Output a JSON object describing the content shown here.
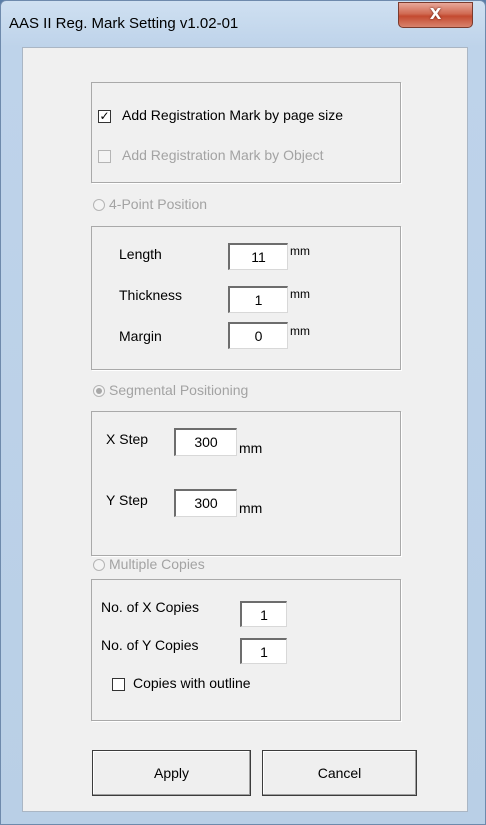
{
  "window": {
    "title": "AAS II Reg. Mark Setting v1.02-01",
    "close_label": "X"
  },
  "options": {
    "by_page_size": {
      "label": "Add Registration Mark by page size",
      "checked": true
    },
    "by_object": {
      "label": "Add Registration Mark by Object",
      "checked": false
    }
  },
  "four_point": {
    "label": "4-Point Position",
    "length": {
      "label": "Length",
      "value": "11",
      "unit": "mm"
    },
    "thickness": {
      "label": "Thickness",
      "value": "1",
      "unit": "mm"
    },
    "margin": {
      "label": "Margin",
      "value": "0",
      "unit": "mm"
    }
  },
  "segmental": {
    "label": "Segmental Positioning",
    "selected": true,
    "x_step": {
      "label": "X Step",
      "value": "300",
      "unit": "mm"
    },
    "y_step": {
      "label": "Y Step",
      "value": "300",
      "unit": "mm"
    }
  },
  "multiple": {
    "label": "Multiple Copies",
    "x_copies": {
      "label": "No. of X Copies",
      "value": "1"
    },
    "y_copies": {
      "label": "No. of Y Copies",
      "value": "1"
    },
    "outline": {
      "label": "Copies with outline",
      "checked": false
    }
  },
  "buttons": {
    "apply": "Apply",
    "cancel": "Cancel"
  }
}
